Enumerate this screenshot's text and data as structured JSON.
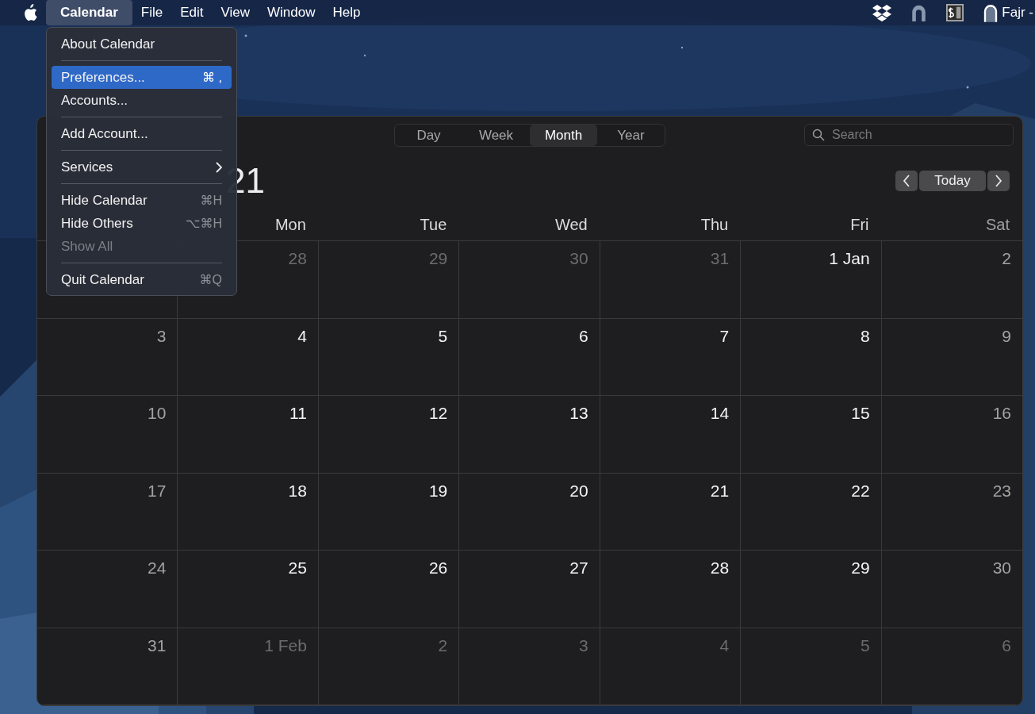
{
  "menu_bar": {
    "menus": [
      {
        "label": "Calendar",
        "selected": true
      },
      {
        "label": "File",
        "selected": false
      },
      {
        "label": "Edit",
        "selected": false
      },
      {
        "label": "View",
        "selected": false
      },
      {
        "label": "Window",
        "selected": false
      },
      {
        "label": "Help",
        "selected": false
      }
    ],
    "status_text": "Fajr -"
  },
  "app_menu": {
    "items": [
      {
        "label": "About Calendar",
        "selected": false,
        "disabled": false,
        "separator_before": false,
        "kind": "item"
      },
      {
        "label": "Preferences...",
        "shortcut": "⌘ ,",
        "selected": true,
        "disabled": false,
        "separator_before": true,
        "kind": "item"
      },
      {
        "label": "Accounts...",
        "selected": false,
        "disabled": false,
        "separator_before": false,
        "kind": "item"
      },
      {
        "label": "Add Account...",
        "selected": false,
        "disabled": false,
        "separator_before": true,
        "kind": "item"
      },
      {
        "label": "Services",
        "selected": false,
        "disabled": false,
        "separator_before": true,
        "kind": "submenu"
      },
      {
        "label": "Hide Calendar",
        "shortcut": "⌘H",
        "selected": false,
        "disabled": false,
        "separator_before": true,
        "kind": "item"
      },
      {
        "label": "Hide Others",
        "shortcut": "⌥⌘H",
        "selected": false,
        "disabled": false,
        "separator_before": false,
        "kind": "item"
      },
      {
        "label": "Show All",
        "selected": false,
        "disabled": true,
        "separator_before": false,
        "kind": "item"
      },
      {
        "label": "Quit Calendar",
        "shortcut": "⌘Q",
        "selected": false,
        "disabled": false,
        "separator_before": true,
        "kind": "item"
      }
    ]
  },
  "toolbar": {
    "views": [
      {
        "label": "Day",
        "selected": false
      },
      {
        "label": "Week",
        "selected": false
      },
      {
        "label": "Month",
        "selected": true
      },
      {
        "label": "Year",
        "selected": false
      }
    ],
    "search": {
      "placeholder": "Search"
    }
  },
  "title": "21",
  "today_button": "Today",
  "weekdays": [
    {
      "label": "Mon",
      "weekend": false
    },
    {
      "label": "Tue",
      "weekend": false
    },
    {
      "label": "Wed",
      "weekend": false
    },
    {
      "label": "Thu",
      "weekend": false
    },
    {
      "label": "Fri",
      "weekend": false
    },
    {
      "label": "Sat",
      "weekend": true
    }
  ],
  "weeks": [
    {
      "days": [
        {
          "label": "28",
          "kind": "adjacent"
        },
        {
          "label": "29",
          "kind": "adjacent"
        },
        {
          "label": "30",
          "kind": "adjacent"
        },
        {
          "label": "31",
          "kind": "adjacent"
        },
        {
          "label": "1 Jan",
          "kind": "weekday"
        },
        {
          "label": "2",
          "kind": "weekend"
        }
      ]
    },
    {
      "days": [
        {
          "label": "3",
          "kind": "weekend"
        },
        {
          "label": "4",
          "kind": "weekday"
        },
        {
          "label": "5",
          "kind": "weekday"
        },
        {
          "label": "6",
          "kind": "weekday"
        },
        {
          "label": "7",
          "kind": "weekday"
        },
        {
          "label": "8",
          "kind": "weekday"
        },
        {
          "label": "9",
          "kind": "weekend"
        }
      ]
    },
    {
      "days": [
        {
          "label": "10",
          "kind": "weekend"
        },
        {
          "label": "11",
          "kind": "weekday"
        },
        {
          "label": "12",
          "kind": "weekday"
        },
        {
          "label": "13",
          "kind": "weekday"
        },
        {
          "label": "14",
          "kind": "weekday"
        },
        {
          "label": "15",
          "kind": "weekday"
        },
        {
          "label": "16",
          "kind": "weekend"
        }
      ]
    },
    {
      "days": [
        {
          "label": "17",
          "kind": "weekend"
        },
        {
          "label": "18",
          "kind": "weekday"
        },
        {
          "label": "19",
          "kind": "weekday"
        },
        {
          "label": "20",
          "kind": "weekday"
        },
        {
          "label": "21",
          "kind": "weekday"
        },
        {
          "label": "22",
          "kind": "weekday"
        },
        {
          "label": "23",
          "kind": "weekend"
        }
      ]
    },
    {
      "days": [
        {
          "label": "24",
          "kind": "weekend"
        },
        {
          "label": "25",
          "kind": "weekday"
        },
        {
          "label": "26",
          "kind": "weekday"
        },
        {
          "label": "27",
          "kind": "weekday"
        },
        {
          "label": "28",
          "kind": "weekday"
        },
        {
          "label": "29",
          "kind": "weekday"
        },
        {
          "label": "30",
          "kind": "weekend"
        }
      ]
    },
    {
      "days": [
        {
          "label": "31",
          "kind": "weekend"
        },
        {
          "label": "1 Feb",
          "kind": "adjacent"
        },
        {
          "label": "2",
          "kind": "adjacent"
        },
        {
          "label": "3",
          "kind": "adjacent"
        },
        {
          "label": "4",
          "kind": "adjacent"
        },
        {
          "label": "5",
          "kind": "adjacent"
        },
        {
          "label": "6",
          "kind": "adjacent"
        }
      ]
    }
  ]
}
